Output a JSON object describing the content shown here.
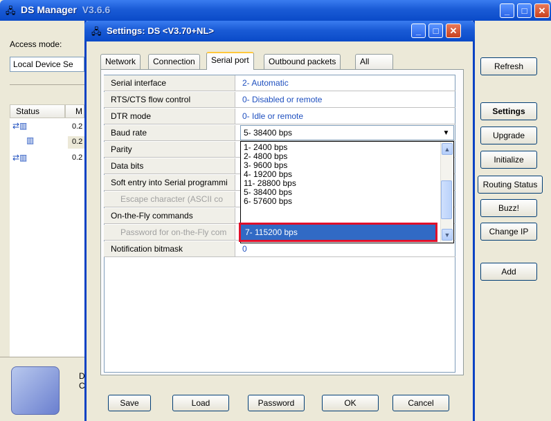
{
  "main_window": {
    "title": "DS Manager",
    "version": "V3.6.6",
    "access_mode_label": "Access mode:",
    "access_mode_value": "Local Device Se",
    "refresh_label": "Refresh",
    "list_headers": [
      "Status",
      "M"
    ],
    "list_rows": [
      "0.2",
      "0.2",
      "0.2"
    ],
    "right_buttons": [
      "Settings",
      "Upgrade",
      "Initialize",
      "Routing Status",
      "Buzz!",
      "Change IP",
      "Add"
    ],
    "bottom_info": [
      "D",
      "C"
    ]
  },
  "settings_window": {
    "title": "Settings: DS <V3.70+NL>",
    "tabs": [
      "Network",
      "Connection",
      "Serial port",
      "Outbound packets",
      "All"
    ],
    "active_tab": "Serial port",
    "rows": [
      {
        "name": "Serial interface",
        "value": "2- Automatic",
        "sub": false
      },
      {
        "name": "RTS/CTS flow control",
        "value": "0- Disabled or remote",
        "sub": false
      },
      {
        "name": "DTR mode",
        "value": "0- Idle or remote",
        "sub": false
      },
      {
        "name": "Baud rate",
        "value": "",
        "sub": false
      },
      {
        "name": "Parity",
        "value": "",
        "sub": false
      },
      {
        "name": "Data bits",
        "value": "",
        "sub": false
      },
      {
        "name": "Soft entry into Serial programmi",
        "value": "",
        "sub": false
      },
      {
        "name": "Escape character (ASCII co",
        "value": "",
        "sub": true
      },
      {
        "name": "On-the-Fly commands",
        "value": "",
        "sub": false
      },
      {
        "name": "Password for on-the-Fly com",
        "value": "",
        "sub": true
      },
      {
        "name": "Notification bitmask",
        "value": "0",
        "sub": false
      }
    ],
    "baud_dropdown": {
      "selected": "5- 38400 bps",
      "options": [
        "1- 2400 bps",
        "2- 4800 bps",
        "3- 9600 bps",
        "4- 19200 bps",
        "11- 28800 bps",
        "5- 38400 bps",
        "6- 57600 bps"
      ],
      "highlighted": "7- 115200 bps"
    },
    "buttons": [
      "Save",
      "Load",
      "Password",
      "OK",
      "Cancel"
    ]
  }
}
